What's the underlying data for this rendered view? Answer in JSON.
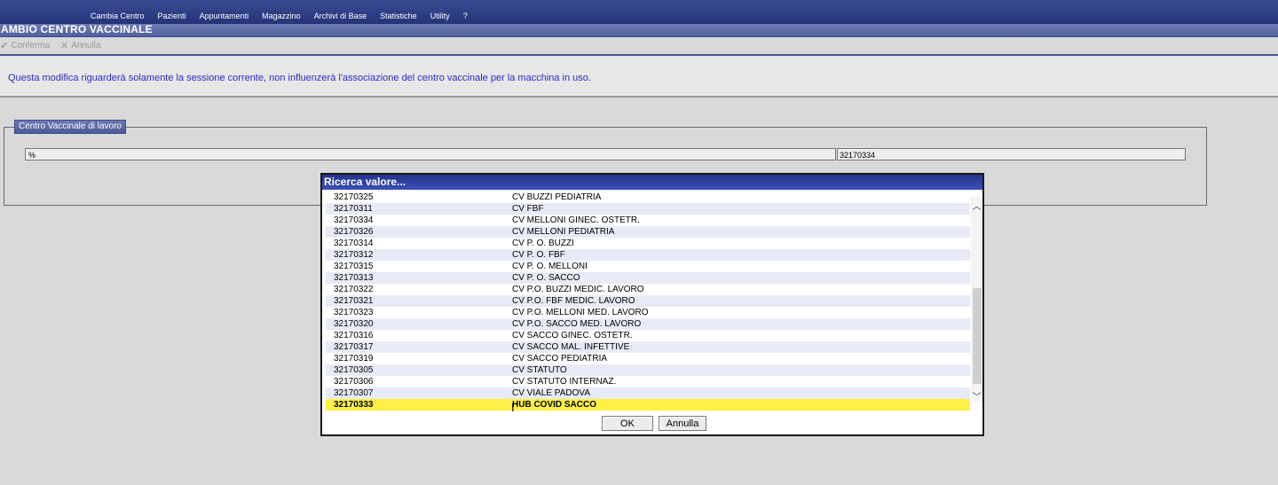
{
  "menu": {
    "items": [
      "Cambia Centro",
      "Pazienti",
      "Appuntamenti",
      "Magazzino",
      "Archivi di Base",
      "Statistiche",
      "Utility",
      "?"
    ]
  },
  "window": {
    "title": "AMBIO CENTRO VACCINALE"
  },
  "toolbar": {
    "confirm_label": "Conferma",
    "cancel_label": "Annulla",
    "confirm_icon": "check-icon",
    "cancel_icon": "x-icon"
  },
  "info": {
    "message": "Questa modifica riguarderà solamente la sessione corrente, non influenzerà l'associazione del centro vaccinale per la macchina in uso."
  },
  "group": {
    "legend": "Centro Vaccinale di lavoro",
    "description_value": "%",
    "code_value": "32170334"
  },
  "dialog": {
    "title": "Ricerca valore...",
    "rows": [
      {
        "code": "32170325",
        "desc": "CV BUZZI PEDIATRIA"
      },
      {
        "code": "32170311",
        "desc": "CV FBF"
      },
      {
        "code": "32170334",
        "desc": "CV MELLONI GINEC. OSTETR."
      },
      {
        "code": "32170326",
        "desc": "CV MELLONI PEDIATRIA"
      },
      {
        "code": "32170314",
        "desc": "CV P. O. BUZZI"
      },
      {
        "code": "32170312",
        "desc": "CV P. O. FBF"
      },
      {
        "code": "32170315",
        "desc": "CV P. O. MELLONI"
      },
      {
        "code": "32170313",
        "desc": "CV P. O. SACCO"
      },
      {
        "code": "32170322",
        "desc": "CV P.O. BUZZI MEDIC. LAVORO"
      },
      {
        "code": "32170321",
        "desc": "CV P.O. FBF MEDIC. LAVORO"
      },
      {
        "code": "32170323",
        "desc": "CV P.O. MELLONI MED. LAVORO"
      },
      {
        "code": "32170320",
        "desc": "CV P.O. SACCO MED. LAVORO"
      },
      {
        "code": "32170316",
        "desc": "CV SACCO GINEC. OSTETR."
      },
      {
        "code": "32170317",
        "desc": "CV SACCO MAL. INFETTIVE"
      },
      {
        "code": "32170319",
        "desc": "CV SACCO PEDIATRIA"
      },
      {
        "code": "32170305",
        "desc": "CV STATUTO"
      },
      {
        "code": "32170306",
        "desc": "CV STATUTO INTERNAZ."
      },
      {
        "code": "32170307",
        "desc": "CV VIALE PADOVA"
      },
      {
        "code": "32170333",
        "desc": "HUB COVID SACCO",
        "selected": true
      }
    ],
    "ok_label": "OK",
    "cancel_label": "Annulla"
  },
  "colors": {
    "menubar": "#2c3d84",
    "dialog_title": "#2a3a9e",
    "selected_row": "#fff045",
    "info_text": "#2a2ac8"
  }
}
